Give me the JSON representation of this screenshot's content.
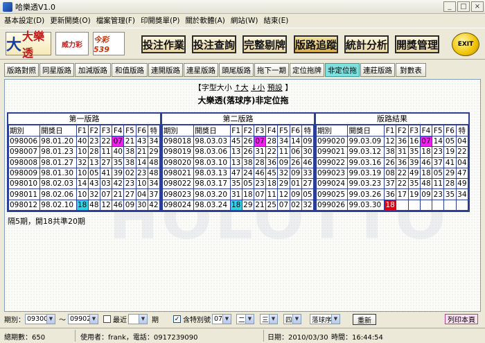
{
  "window": {
    "title": "哈樂透V1.0",
    "buttons": [
      "_",
      "□",
      "×"
    ]
  },
  "menu": [
    "基本設定(D)",
    "更新開獎(O)",
    "檔案管理(F)",
    "印開獎單(P)",
    "關於軟體(A)",
    "網站(W)",
    "結束(E)"
  ],
  "logos": {
    "daletou": "大樂透",
    "daletou_big": "大",
    "logo2": "威力彩",
    "logo3": "今彩539"
  },
  "toolbar": {
    "buttons": [
      "投注作業",
      "投注查詢",
      "完整剔牌",
      "版路追蹤",
      "統計分析",
      "開獎管理"
    ],
    "active": "版路追蹤",
    "exit_label": "EXIT"
  },
  "tabs": [
    "版路對照",
    "同星版路",
    "加減版路",
    "和值版路",
    "連開版路",
    "連星版路",
    "頭尾版路",
    "拖下一期",
    "定位拖牌",
    "非定位拖",
    "連莊版路",
    "對數表"
  ],
  "active_tab": "非定位拖",
  "fontline": {
    "prefix": "【字型大小",
    "up": "↑大",
    "down": "↓小",
    "preset": "預設",
    "suffix": "】"
  },
  "heading": "大樂透(落球序)非定位拖",
  "col_headers": [
    "期別",
    "開獎日",
    "F1",
    "F2",
    "F3",
    "F4",
    "F5",
    "F6",
    "特"
  ],
  "groups": [
    {
      "title": "第一版路",
      "rows": [
        [
          "098006",
          "98.01.20",
          "40",
          "23",
          "22",
          "07",
          "21",
          "43",
          "34"
        ],
        [
          "098007",
          "98.01.23",
          "10",
          "28",
          "11",
          "40",
          "38",
          "21",
          "29"
        ],
        [
          "098008",
          "98.01.27",
          "32",
          "13",
          "27",
          "35",
          "38",
          "14",
          "48"
        ],
        [
          "098009",
          "98.01.30",
          "10",
          "05",
          "41",
          "39",
          "02",
          "23",
          "48"
        ],
        [
          "098010",
          "98.02.03",
          "14",
          "43",
          "03",
          "42",
          "23",
          "10",
          "34"
        ],
        [
          "098011",
          "98.02.06",
          "10",
          "32",
          "07",
          "21",
          "27",
          "04",
          "37"
        ],
        [
          "098012",
          "98.02.10",
          "18",
          "48",
          "12",
          "46",
          "09",
          "30",
          "42"
        ]
      ]
    },
    {
      "title": "第二版路",
      "rows": [
        [
          "098018",
          "98.03.03",
          "45",
          "26",
          "07",
          "28",
          "34",
          "14",
          "09"
        ],
        [
          "098019",
          "98.03.06",
          "13",
          "26",
          "31",
          "22",
          "11",
          "06",
          "30"
        ],
        [
          "098020",
          "98.03.10",
          "13",
          "38",
          "28",
          "36",
          "09",
          "26",
          "46"
        ],
        [
          "098021",
          "98.03.13",
          "47",
          "24",
          "46",
          "45",
          "32",
          "09",
          "33"
        ],
        [
          "098022",
          "98.03.17",
          "35",
          "05",
          "23",
          "18",
          "29",
          "01",
          "27"
        ],
        [
          "098023",
          "98.03.20",
          "31",
          "18",
          "07",
          "11",
          "12",
          "09",
          "05"
        ],
        [
          "098024",
          "98.03.24",
          "18",
          "29",
          "21",
          "25",
          "07",
          "02",
          "32"
        ]
      ]
    },
    {
      "title": "版路結果",
      "rows": [
        [
          "099020",
          "99.03.09",
          "12",
          "36",
          "16",
          "07",
          "14",
          "05",
          "04"
        ],
        [
          "099021",
          "99.03.12",
          "38",
          "31",
          "35",
          "18",
          "23",
          "19",
          "22"
        ],
        [
          "099022",
          "99.03.16",
          "26",
          "36",
          "39",
          "46",
          "37",
          "41",
          "04"
        ],
        [
          "099023",
          "99.03.19",
          "08",
          "22",
          "49",
          "18",
          "05",
          "29",
          "47"
        ],
        [
          "099024",
          "99.03.23",
          "37",
          "22",
          "35",
          "48",
          "11",
          "28",
          "49"
        ],
        [
          "099025",
          "99.03.26",
          "36",
          "17",
          "19",
          "09",
          "23",
          "35",
          "34"
        ],
        [
          "099026",
          "99.03.30",
          "18",
          "",
          "",
          "",
          "",
          "",
          ""
        ]
      ]
    }
  ],
  "note": "隔5期，開18共準20期",
  "bottom": {
    "period_label": "期別：",
    "period_from": "093001",
    "tilde": "～",
    "period_to": "099025",
    "recent_label": "最近",
    "recent_value": "",
    "period_suffix": "期",
    "special_label": "含特別號",
    "special_checked": "✓",
    "num_select": "07",
    "sel2": "二",
    "sel3": "三",
    "sel4": "四",
    "order_select": "落球序",
    "go_button": "重新",
    "print_button": "列印本頁"
  },
  "status": {
    "total": "總期數：650",
    "user": "使用者：frank，電話：0917239090",
    "date": "日期：2010/03/30",
    "time": "時間：16:44:54"
  }
}
